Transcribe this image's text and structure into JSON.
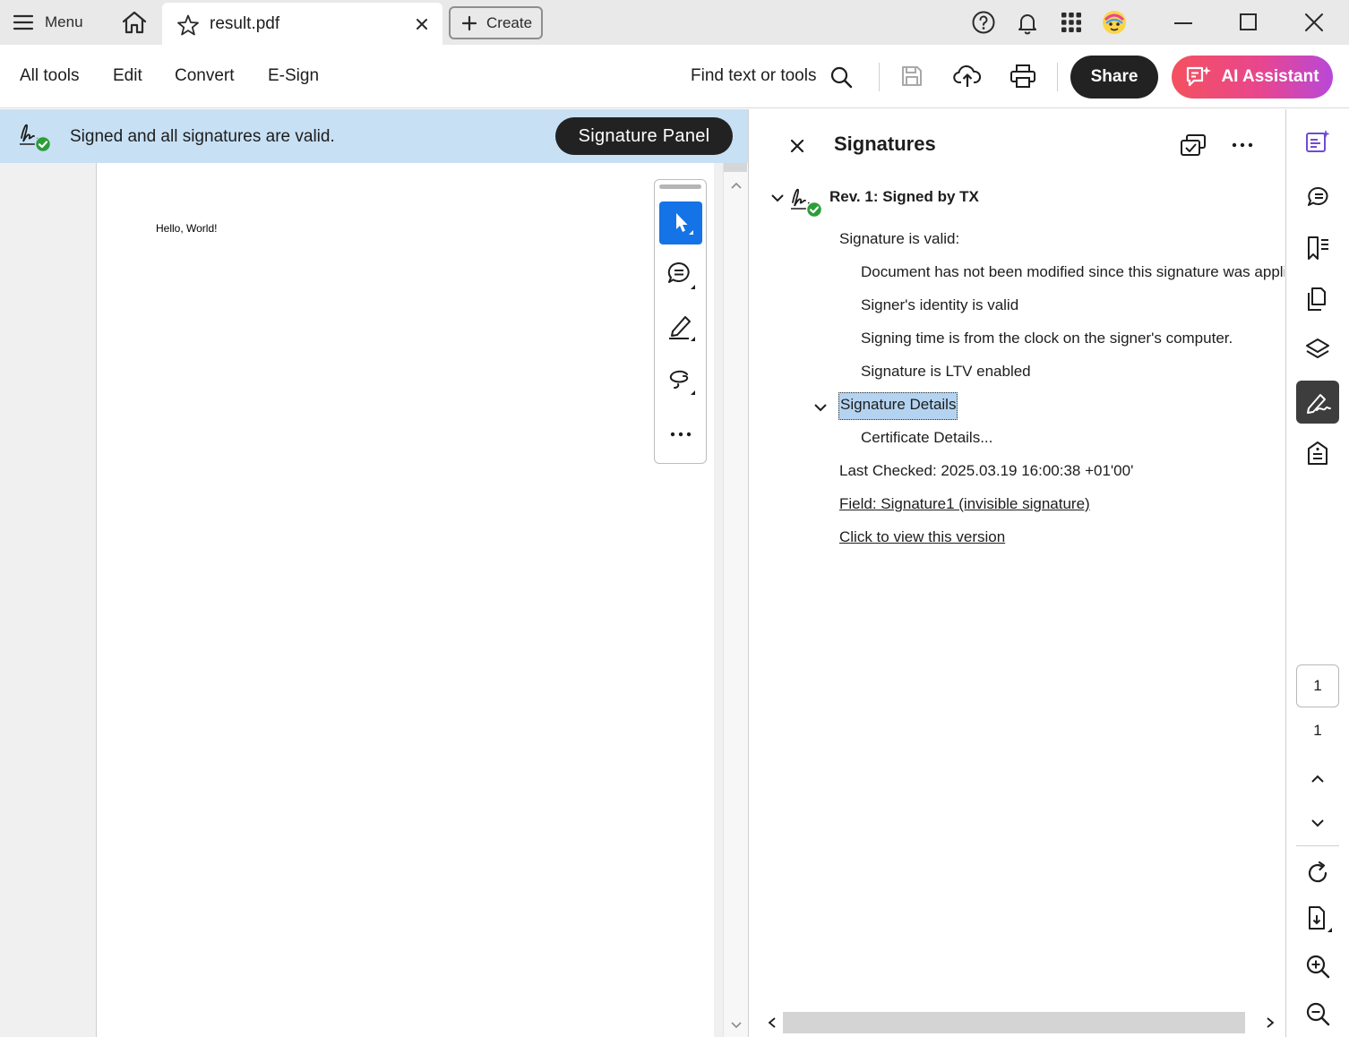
{
  "titlebar": {
    "menu_label": "Menu",
    "tab_title": "result.pdf",
    "create_label": "Create"
  },
  "toolbar": {
    "nav": [
      "All tools",
      "Edit",
      "Convert",
      "E-Sign"
    ],
    "find_label": "Find text or tools",
    "share_label": "Share",
    "ai_label": "AI Assistant"
  },
  "banner": {
    "text": "Signed and all signatures are valid.",
    "button_label": "Signature Panel"
  },
  "document": {
    "text": "Hello, World!"
  },
  "signatures_panel": {
    "title": "Signatures",
    "revision_label": "Rev. 1: Signed by TX",
    "validity_heading": "Signature is valid:",
    "validity_items": [
      "Document has not been modified since this signature was applied",
      "Signer's identity is valid",
      "Signing time is from the clock on the signer's computer.",
      "Signature is LTV enabled"
    ],
    "details_label": "Signature Details",
    "certificate_label": "Certificate Details...",
    "last_checked": "Last Checked: 2025.03.19 16:00:38 +01'00'",
    "field_link": "Field: Signature1 (invisible signature)",
    "view_version_link": "Click to view this version"
  },
  "rail": {
    "current_page": "1",
    "total_pages": "1"
  },
  "colors": {
    "accent_blue": "#1473e6",
    "banner_bg": "#c7e0f4",
    "valid_green": "#2d9d3a",
    "dark_button": "#222222"
  }
}
